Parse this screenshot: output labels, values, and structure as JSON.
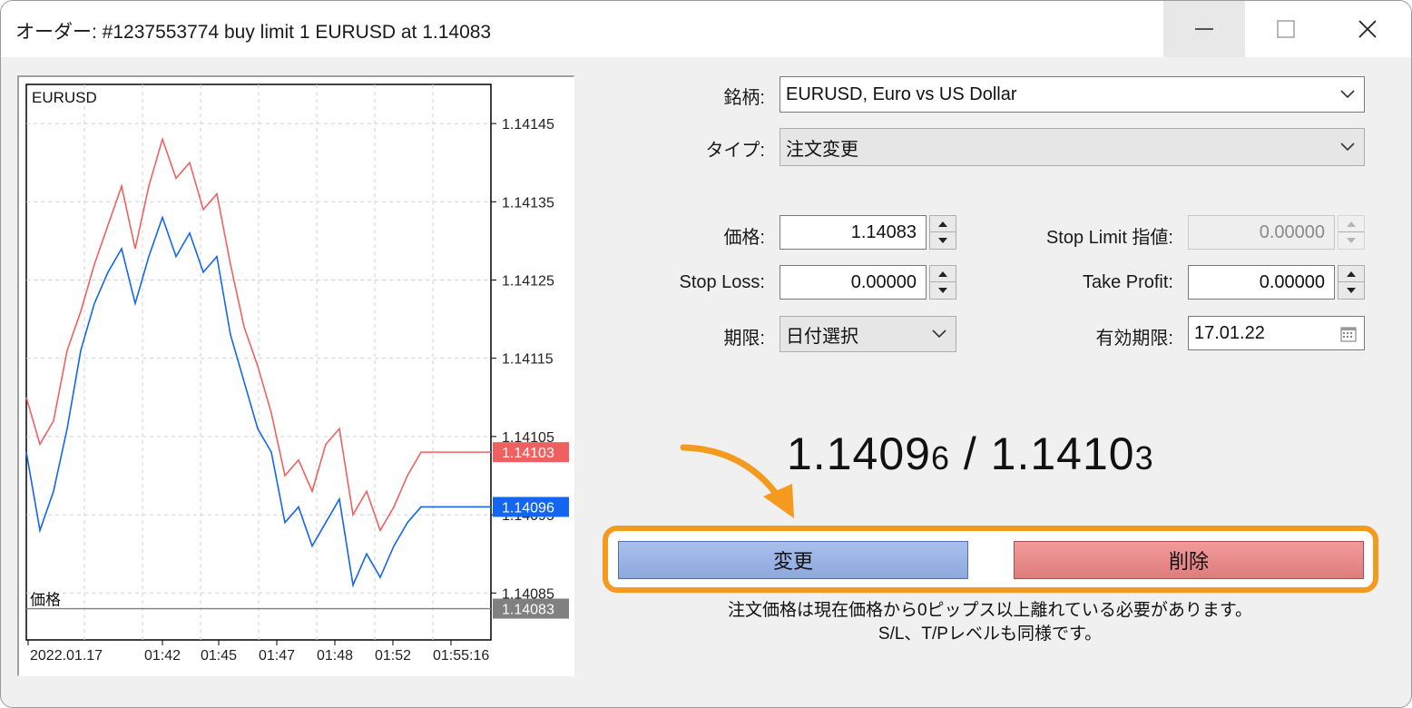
{
  "window": {
    "title": "オーダー: #1237553774 buy limit 1 EURUSD at 1.14083",
    "controls": [
      "minimize-icon",
      "maximize-icon",
      "close-icon"
    ]
  },
  "chart": {
    "symbol": "EURUSD",
    "price_label": "価格",
    "y_ticks": [
      "1.14145",
      "1.14135",
      "1.14125",
      "1.14115",
      "1.14105",
      "1.14095",
      "1.14085"
    ],
    "x_ticks": [
      "2022.01.17",
      "01:42",
      "01:45",
      "01:47",
      "01:48",
      "01:52",
      "01:55:16"
    ],
    "ask_tag": "1.14103",
    "bid_tag": "1.14096",
    "order_tag": "1.14083",
    "colors": {
      "ask": "#f06060",
      "bid": "#1466f0",
      "order": "#808080"
    }
  },
  "chart_data": {
    "type": "line",
    "ylim": [
      1.14079,
      1.1415
    ],
    "series": [
      {
        "values": [
          1.1411,
          1.14104,
          1.14107,
          1.14116,
          1.14121,
          1.14127,
          1.14132,
          1.14137,
          1.14129,
          1.14137,
          1.14143,
          1.14138,
          1.1414,
          1.14134,
          1.14136,
          1.14127,
          1.14119,
          1.14114,
          1.14108,
          1.141,
          1.14102,
          1.14098,
          1.14104,
          1.14106,
          1.14095,
          1.14098,
          1.14093,
          1.14096,
          1.141,
          1.14103,
          1.14103
        ]
      },
      {
        "values": [
          1.14103,
          1.14093,
          1.14098,
          1.14106,
          1.14116,
          1.14122,
          1.14126,
          1.14129,
          1.14122,
          1.14128,
          1.14133,
          1.14128,
          1.14131,
          1.14126,
          1.14128,
          1.14118,
          1.14112,
          1.14106,
          1.14103,
          1.14094,
          1.14096,
          1.14091,
          1.14094,
          1.14097,
          1.14086,
          1.1409,
          1.14087,
          1.14091,
          1.14094,
          1.14096,
          1.14096
        ]
      },
      {
        "values": [
          1.14083,
          1.14083
        ]
      }
    ]
  },
  "form": {
    "symbol_label": "銘柄:",
    "symbol_value": "EURUSD, Euro vs US Dollar",
    "type_label": "タイプ:",
    "type_value": "注文変更",
    "price_label": "価格:",
    "price_value": "1.14083",
    "stoplimit_label": "Stop Limit 指値:",
    "stoplimit_value": "0.00000",
    "sl_label": "Stop Loss:",
    "sl_value": "0.00000",
    "tp_label": "Take Profit:",
    "tp_value": "0.00000",
    "expiry_label": "期限:",
    "expiry_value": "日付選択",
    "valid_label": "有効期限:",
    "valid_value": "17.01.22"
  },
  "quote": {
    "bid_main": "1.1409",
    "bid_small": "6",
    "separator": " / ",
    "ask_main": "1.1410",
    "ask_small": "3"
  },
  "buttons": {
    "modify": "変更",
    "delete": "削除"
  },
  "notes": {
    "line1": "注文価格は現在価格から0ピップス以上離れている必要があります。",
    "line2": "S/L、T/Pレベルも同様です。"
  },
  "accent": "#f39a1f"
}
